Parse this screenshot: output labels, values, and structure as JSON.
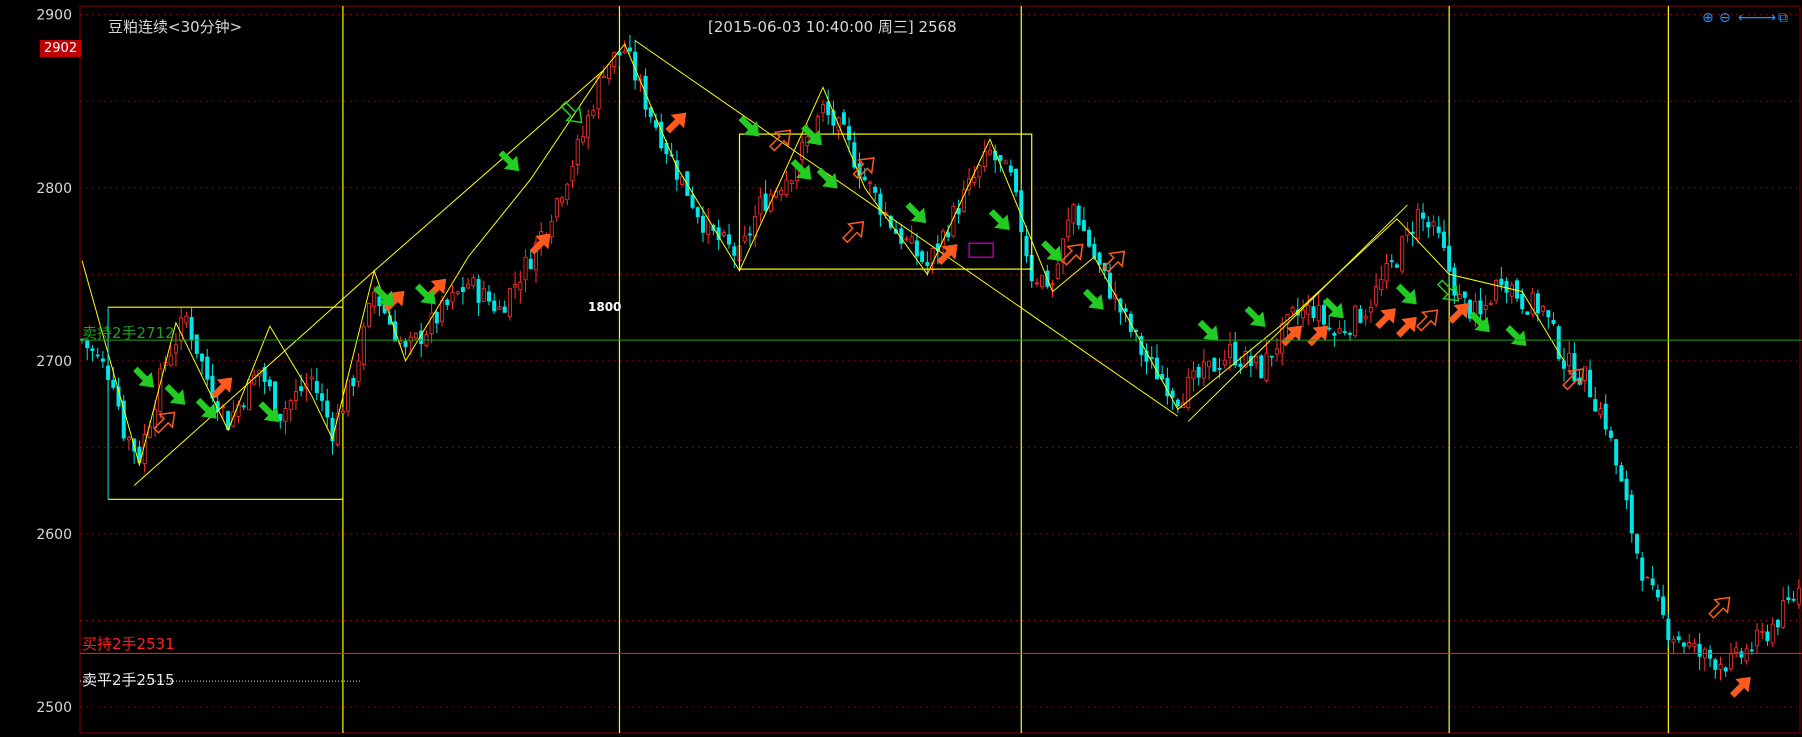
{
  "title": "豆粕连续<30分钟>",
  "cursor_info": "[2015-06-03  10:40:00 周三]    2568",
  "y_top_badge": "2902",
  "zigzag_label": "1800",
  "levels": {
    "buy_hold": {
      "label": "买持2手2531",
      "value": 2531,
      "color": "#ff2020"
    },
    "sell_flat": {
      "label": "卖平2手2515",
      "value": 2515,
      "color": "#e8e8e8"
    },
    "green_hold": {
      "label": "卖持2手2712",
      "value": 2712,
      "color": "#1fa01f"
    }
  },
  "toolbar": [
    "zoom-in-icon",
    "zoom-out-icon",
    "pan-left-icon",
    "pan-right-icon",
    "restore-icon"
  ],
  "colors": {
    "up": "#ff3030",
    "down": "#00e5e5",
    "lines": "#ffff00",
    "grid": "#8b0000",
    "buy_arrow": "#ff5a1e",
    "sell_arrow": "#22cc22"
  },
  "chart_data": {
    "type": "candlestick",
    "title": "豆粕连续<30分钟>",
    "ylim": [
      2485,
      2905
    ],
    "y_ticks": [
      2900,
      2800,
      2700,
      2600,
      2500
    ],
    "x_count": 330,
    "vlines_index": [
      50,
      103,
      180,
      262,
      304
    ],
    "close_path": [
      [
        0,
        2712
      ],
      [
        6,
        2690
      ],
      [
        8,
        2660
      ],
      [
        11,
        2645
      ],
      [
        16,
        2700
      ],
      [
        20,
        2725
      ],
      [
        24,
        2690
      ],
      [
        28,
        2665
      ],
      [
        34,
        2695
      ],
      [
        38,
        2670
      ],
      [
        44,
        2690
      ],
      [
        48,
        2660
      ],
      [
        52,
        2690
      ],
      [
        56,
        2740
      ],
      [
        62,
        2705
      ],
      [
        68,
        2725
      ],
      [
        74,
        2745
      ],
      [
        80,
        2730
      ],
      [
        86,
        2760
      ],
      [
        92,
        2800
      ],
      [
        96,
        2830
      ],
      [
        100,
        2870
      ],
      [
        104,
        2880
      ],
      [
        108,
        2850
      ],
      [
        114,
        2810
      ],
      [
        120,
        2775
      ],
      [
        126,
        2760
      ],
      [
        130,
        2790
      ],
      [
        136,
        2810
      ],
      [
        142,
        2845
      ],
      [
        146,
        2830
      ],
      [
        150,
        2805
      ],
      [
        156,
        2775
      ],
      [
        162,
        2755
      ],
      [
        168,
        2790
      ],
      [
        174,
        2820
      ],
      [
        178,
        2805
      ],
      [
        182,
        2750
      ],
      [
        186,
        2745
      ],
      [
        190,
        2790
      ],
      [
        194,
        2760
      ],
      [
        198,
        2735
      ],
      [
        204,
        2700
      ],
      [
        210,
        2680
      ],
      [
        214,
        2690
      ],
      [
        220,
        2705
      ],
      [
        226,
        2695
      ],
      [
        232,
        2725
      ],
      [
        236,
        2730
      ],
      [
        240,
        2715
      ],
      [
        246,
        2730
      ],
      [
        252,
        2760
      ],
      [
        256,
        2785
      ],
      [
        260,
        2770
      ],
      [
        264,
        2735
      ],
      [
        268,
        2725
      ],
      [
        272,
        2750
      ],
      [
        276,
        2735
      ],
      [
        280,
        2730
      ],
      [
        284,
        2700
      ],
      [
        288,
        2690
      ],
      [
        292,
        2665
      ],
      [
        294,
        2640
      ],
      [
        298,
        2590
      ],
      [
        300,
        2570
      ],
      [
        304,
        2545
      ],
      [
        310,
        2530
      ],
      [
        316,
        2525
      ],
      [
        322,
        2540
      ],
      [
        326,
        2555
      ],
      [
        329,
        2568
      ]
    ]
  }
}
